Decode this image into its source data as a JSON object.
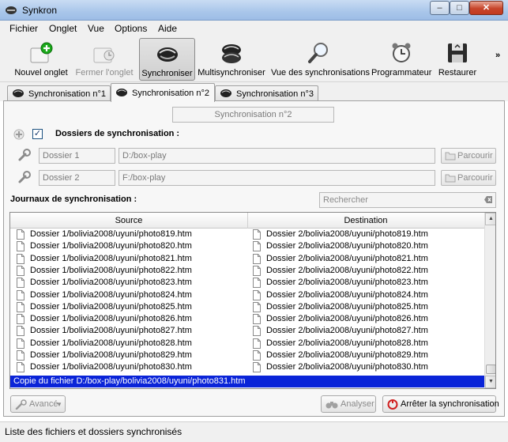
{
  "window": {
    "title": "Synkron",
    "min": "–",
    "max": "□",
    "close": "✕"
  },
  "menu": [
    "Fichier",
    "Onglet",
    "Vue",
    "Options",
    "Aide"
  ],
  "toolbar": {
    "items": [
      {
        "label": "Nouvel onglet",
        "icon": "new-tab-icon",
        "state": "enabled"
      },
      {
        "label": "Fermer l'onglet",
        "icon": "close-tab-icon",
        "state": "disabled"
      },
      {
        "label": "Synchroniser",
        "icon": "synchronize-icon",
        "state": "active"
      },
      {
        "label": "Multisynchroniser",
        "icon": "multisync-icon",
        "state": "enabled"
      },
      {
        "label": "Vue des synchronisations",
        "icon": "magnifier-icon",
        "state": "enabled"
      },
      {
        "label": "Programmateur",
        "icon": "alarm-clock-icon",
        "state": "enabled"
      },
      {
        "label": "Restaurer",
        "icon": "restore-floppy-icon",
        "state": "enabled"
      }
    ],
    "more": "»"
  },
  "tabs": [
    {
      "label": "Synchronisation n°1",
      "selected": false
    },
    {
      "label": "Synchronisation n°2",
      "selected": true
    },
    {
      "label": "Synchronisation n°3",
      "selected": false
    }
  ],
  "sync": {
    "name": "Synchronisation n°2",
    "folders_checkbox": "✓",
    "folders_title": "Dossiers de synchronisation :",
    "folders": [
      {
        "name": "Dossier 1",
        "path": "D:/box-play",
        "browse": "Parcourir"
      },
      {
        "name": "Dossier 2",
        "path": "F:/box-play",
        "browse": "Parcourir"
      }
    ],
    "logs_title": "Journaux de synchronisation :",
    "search_placeholder": "Rechercher"
  },
  "log_table": {
    "headers": [
      "Source",
      "Destination"
    ],
    "rows": [
      [
        "Dossier 1/bolivia2008/uyuni/photo819.htm",
        "Dossier 2/bolivia2008/uyuni/photo819.htm"
      ],
      [
        "Dossier 1/bolivia2008/uyuni/photo820.htm",
        "Dossier 2/bolivia2008/uyuni/photo820.htm"
      ],
      [
        "Dossier 1/bolivia2008/uyuni/photo821.htm",
        "Dossier 2/bolivia2008/uyuni/photo821.htm"
      ],
      [
        "Dossier 1/bolivia2008/uyuni/photo822.htm",
        "Dossier 2/bolivia2008/uyuni/photo822.htm"
      ],
      [
        "Dossier 1/bolivia2008/uyuni/photo823.htm",
        "Dossier 2/bolivia2008/uyuni/photo823.htm"
      ],
      [
        "Dossier 1/bolivia2008/uyuni/photo824.htm",
        "Dossier 2/bolivia2008/uyuni/photo824.htm"
      ],
      [
        "Dossier 1/bolivia2008/uyuni/photo825.htm",
        "Dossier 2/bolivia2008/uyuni/photo825.htm"
      ],
      [
        "Dossier 1/bolivia2008/uyuni/photo826.htm",
        "Dossier 2/bolivia2008/uyuni/photo826.htm"
      ],
      [
        "Dossier 1/bolivia2008/uyuni/photo827.htm",
        "Dossier 2/bolivia2008/uyuni/photo827.htm"
      ],
      [
        "Dossier 1/bolivia2008/uyuni/photo828.htm",
        "Dossier 2/bolivia2008/uyuni/photo828.htm"
      ],
      [
        "Dossier 1/bolivia2008/uyuni/photo829.htm",
        "Dossier 2/bolivia2008/uyuni/photo829.htm"
      ],
      [
        "Dossier 1/bolivia2008/uyuni/photo830.htm",
        "Dossier 2/bolivia2008/uyuni/photo830.htm"
      ]
    ],
    "current": "Copie du fichier D:/box-play/bolivia2008/uyuni/photo831.htm"
  },
  "actions": {
    "advanced": "Avancé",
    "analyze": "Analyser",
    "stop": "Arrêter la synchronisation"
  },
  "status": "Liste des fichiers et dossiers synchronisés",
  "colors": {
    "selection": "#0a24d8",
    "stop_icon": "#d02020",
    "add_green": "#1aa81a"
  }
}
